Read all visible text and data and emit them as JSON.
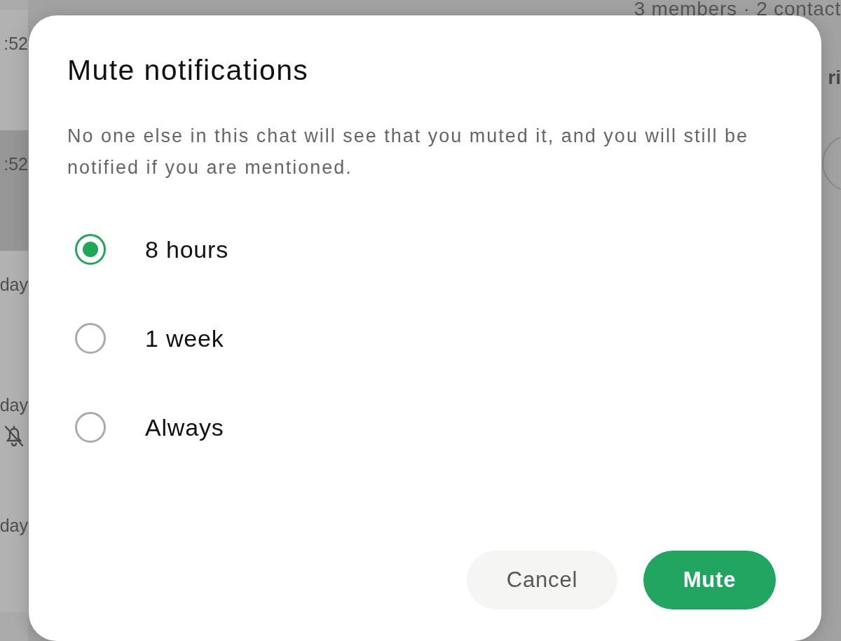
{
  "background": {
    "chat_list": [
      {
        "time": ":52",
        "selected": false,
        "muted": false
      },
      {
        "time": ":52",
        "selected": true,
        "muted": false
      },
      {
        "time": "day",
        "selected": false,
        "muted": false
      },
      {
        "time": "day",
        "selected": false,
        "muted": true
      },
      {
        "time": "day",
        "selected": false,
        "muted": false
      }
    ],
    "header_subtitle": "3 members · 2 contact",
    "panel_text": "ri"
  },
  "dialog": {
    "title": "Mute notifications",
    "description": "No one else in this chat will see that you muted it, and you will still be notified if you are mentioned.",
    "options": [
      {
        "label": "8 hours",
        "selected": true
      },
      {
        "label": "1 week",
        "selected": false
      },
      {
        "label": "Always",
        "selected": false
      }
    ],
    "buttons": [
      {
        "label": "Cancel",
        "kind": "secondary"
      },
      {
        "label": "Mute",
        "kind": "primary"
      }
    ]
  }
}
